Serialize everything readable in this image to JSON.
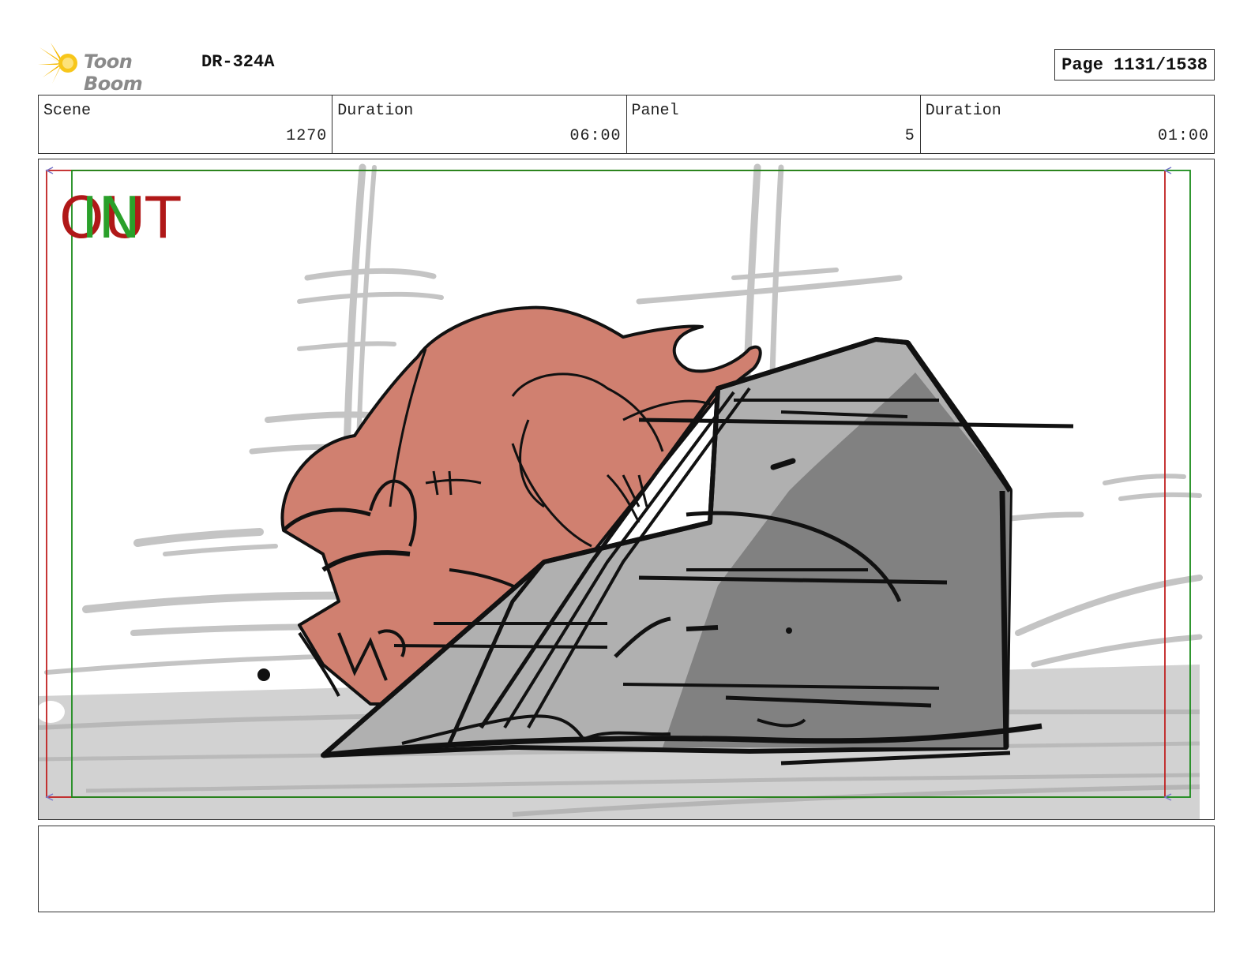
{
  "header": {
    "brand": "Toon Boom",
    "production_code": "DR-324A",
    "page_label": "Page 1131/1538"
  },
  "info": {
    "scene_label": "Scene",
    "scene_value": "1270",
    "scene_duration_label": "Duration",
    "scene_duration_value": "06:00",
    "panel_label": "Panel",
    "panel_value": "5",
    "panel_duration_label": "Duration",
    "panel_duration_value": "01:00"
  },
  "panel": {
    "out_marker": "OUT",
    "in_marker": "IN",
    "colors": {
      "out_frame": "#c02020",
      "in_frame": "#1a8a1a",
      "character_fill": "#d08070",
      "rock_light": "#b0b0b0",
      "rock_dark": "#808080"
    }
  },
  "notes": {
    "text": ""
  }
}
